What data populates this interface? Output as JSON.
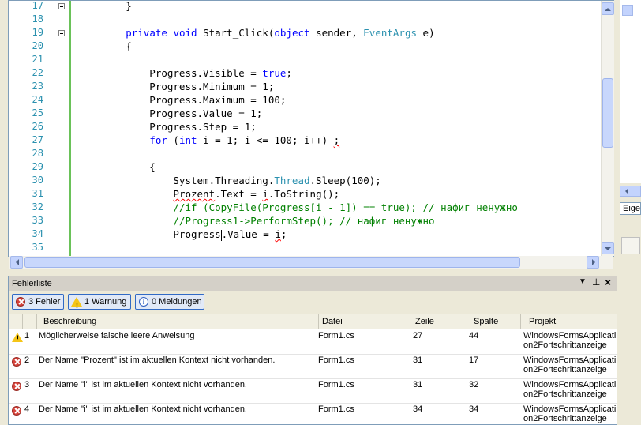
{
  "editor": {
    "lines": [
      {
        "n": "17",
        "parts": [
          {
            "t": "        }",
            "c": ""
          }
        ]
      },
      {
        "n": "18",
        "parts": []
      },
      {
        "n": "19",
        "parts": [
          {
            "t": "        ",
            "c": ""
          },
          {
            "t": "private",
            "c": "kw"
          },
          {
            "t": " ",
            "c": ""
          },
          {
            "t": "void",
            "c": "kw"
          },
          {
            "t": " Start_Click(",
            "c": ""
          },
          {
            "t": "object",
            "c": "kw"
          },
          {
            "t": " sender, ",
            "c": ""
          },
          {
            "t": "EventArgs",
            "c": "ty"
          },
          {
            "t": " e)",
            "c": ""
          }
        ]
      },
      {
        "n": "20",
        "parts": [
          {
            "t": "        {",
            "c": ""
          }
        ]
      },
      {
        "n": "21",
        "parts": []
      },
      {
        "n": "22",
        "parts": [
          {
            "t": "            Progress.Visible = ",
            "c": ""
          },
          {
            "t": "true",
            "c": "kw"
          },
          {
            "t": ";",
            "c": ""
          }
        ]
      },
      {
        "n": "23",
        "parts": [
          {
            "t": "            Progress.Minimum = 1;",
            "c": ""
          }
        ]
      },
      {
        "n": "24",
        "parts": [
          {
            "t": "            Progress.Maximum = 100;",
            "c": ""
          }
        ]
      },
      {
        "n": "25",
        "parts": [
          {
            "t": "            Progress.Value = 1;",
            "c": ""
          }
        ]
      },
      {
        "n": "26",
        "parts": [
          {
            "t": "            Progress.Step = 1;",
            "c": ""
          }
        ]
      },
      {
        "n": "27",
        "parts": [
          {
            "t": "            ",
            "c": ""
          },
          {
            "t": "for",
            "c": "kw"
          },
          {
            "t": " (",
            "c": ""
          },
          {
            "t": "int",
            "c": "kw"
          },
          {
            "t": " i = 1; i <= 100; i++) ",
            "c": ""
          },
          {
            "t": ";",
            "c": "sq"
          }
        ]
      },
      {
        "n": "28",
        "parts": []
      },
      {
        "n": "29",
        "parts": [
          {
            "t": "            {",
            "c": ""
          }
        ]
      },
      {
        "n": "30",
        "parts": [
          {
            "t": "                System.Threading.",
            "c": ""
          },
          {
            "t": "Thread",
            "c": "ty"
          },
          {
            "t": ".Sleep(100);",
            "c": ""
          }
        ]
      },
      {
        "n": "31",
        "parts": [
          {
            "t": "                ",
            "c": ""
          },
          {
            "t": "Prozent",
            "c": "sq"
          },
          {
            "t": ".Text = ",
            "c": ""
          },
          {
            "t": "i",
            "c": "sq"
          },
          {
            "t": ".ToString();",
            "c": ""
          }
        ]
      },
      {
        "n": "32",
        "parts": [
          {
            "t": "                //if (CopyFile(Progress[i - 1]) == true); // нафиг ненужно",
            "c": "cm"
          }
        ]
      },
      {
        "n": "33",
        "parts": [
          {
            "t": "                //Progress1->PerformStep(); // нафиг ненужно",
            "c": "cm"
          }
        ]
      },
      {
        "n": "34",
        "parts": [
          {
            "t": "                Progress",
            "c": ""
          },
          {
            "t": "|",
            "c": "caret"
          },
          {
            "t": ".Value = ",
            "c": ""
          },
          {
            "t": "i",
            "c": "sq"
          },
          {
            "t": ";",
            "c": ""
          }
        ]
      },
      {
        "n": "35",
        "parts": []
      }
    ]
  },
  "sidebar": {
    "tab_label": "Eiger"
  },
  "errorlist": {
    "title": "Fehlerliste",
    "errors_btn": "3 Fehler",
    "warnings_btn": "1 Warnung",
    "messages_btn": "0 Meldungen",
    "columns": [
      "Beschreibung",
      "Datei",
      "Zeile",
      "Spalte",
      "Projekt"
    ],
    "rows": [
      {
        "type": "warn",
        "num": "1",
        "desc": "Möglicherweise falsche leere Anweisung",
        "file": "Form1.cs",
        "line": "27",
        "col": "44",
        "proj1": "WindowsFormsApplicati",
        "proj2": "on2Fortschrittanzeige"
      },
      {
        "type": "err",
        "num": "2",
        "desc": "Der Name \"Prozent\" ist im aktuellen Kontext nicht vorhanden.",
        "file": "Form1.cs",
        "line": "31",
        "col": "17",
        "proj1": "WindowsFormsApplicati",
        "proj2": "on2Fortschrittanzeige"
      },
      {
        "type": "err",
        "num": "3",
        "desc": "Der Name \"i\" ist im aktuellen Kontext nicht vorhanden.",
        "file": "Form1.cs",
        "line": "31",
        "col": "32",
        "proj1": "WindowsFormsApplicati",
        "proj2": "on2Fortschrittanzeige"
      },
      {
        "type": "err",
        "num": "4",
        "desc": "Der Name \"i\" ist im aktuellen Kontext nicht vorhanden.",
        "file": "Form1.cs",
        "line": "34",
        "col": "34",
        "proj1": "WindowsFormsApplicati",
        "proj2": "on2Fortschrittanzeige"
      }
    ]
  }
}
